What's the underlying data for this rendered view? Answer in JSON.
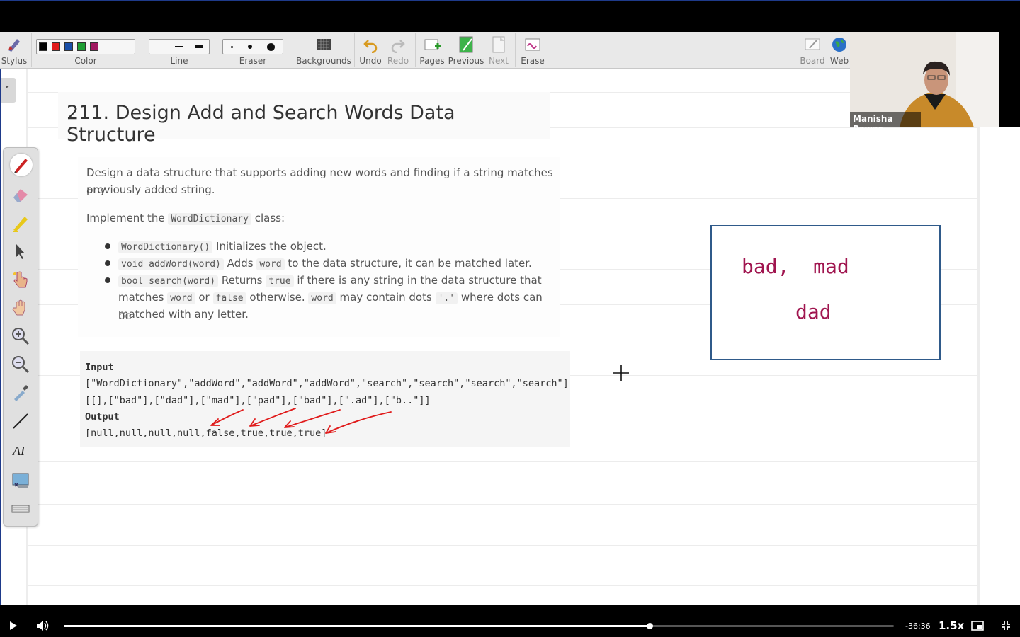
{
  "toolbar": {
    "stylus": "Stylus",
    "color": "Color",
    "line": "Line",
    "eraser": "Eraser",
    "backgrounds": "Backgrounds",
    "undo": "Undo",
    "redo": "Redo",
    "pages": "Pages",
    "previous": "Previous",
    "next": "Next",
    "erase": "Erase",
    "board": "Board",
    "web": "Web",
    "colors": [
      "#000000",
      "#e01b1b",
      "#1a4fa8",
      "#1e9e34",
      "#a01860"
    ]
  },
  "webcam": {
    "name": "Manisha Pawar"
  },
  "problem": {
    "title": "211. Design Add and Search Words Data Structure",
    "desc_line1": "Design a data structure that supports adding new words and finding if a string matches any",
    "desc_line2": "previously added string.",
    "implement_prefix": "Implement the",
    "implement_code": "WordDictionary",
    "implement_suffix": "class:",
    "b1_code": "WordDictionary()",
    "b1_text": "Initializes the object.",
    "b2_code": "void addWord(word)",
    "b2_mid": "Adds",
    "b2_code2": "word",
    "b2_text": "to the data structure, it can be matched later.",
    "b3_code": "bool search(word)",
    "b3_mid": "Returns",
    "b3_code2": "true",
    "b3_text": "if there is any string in the data structure that",
    "b3_l2_prefix": "matches",
    "b3_l2_code1": "word",
    "b3_l2_or": "or",
    "b3_l2_code2": "false",
    "b3_l2_other": "otherwise.",
    "b3_l2_code3": "word",
    "b3_l2_may": "may contain dots",
    "b3_l2_code4": "'.'",
    "b3_l2_where": "where dots can be",
    "b3_l3": "matched with any letter."
  },
  "example": {
    "input_label": "Input",
    "input_line1": "[\"WordDictionary\",\"addWord\",\"addWord\",\"addWord\",\"search\",\"search\",\"search\",\"search\"]",
    "input_line2": "[[],[\"bad\"],[\"dad\"],[\"mad\"],[\"pad\"],[\"bad\"],[\".ad\"],[\"b..\"]]",
    "output_label": "Output",
    "output_line": "[null,null,null,null,false,true,true,true]"
  },
  "annotation": {
    "line1": "bad,  mad",
    "line2": "dad",
    "ink_color": "#a0154f",
    "arrow_color": "#e01b1b"
  },
  "player": {
    "time_remaining": "-36:36",
    "speed": "1.5x",
    "progress": 0.706
  }
}
